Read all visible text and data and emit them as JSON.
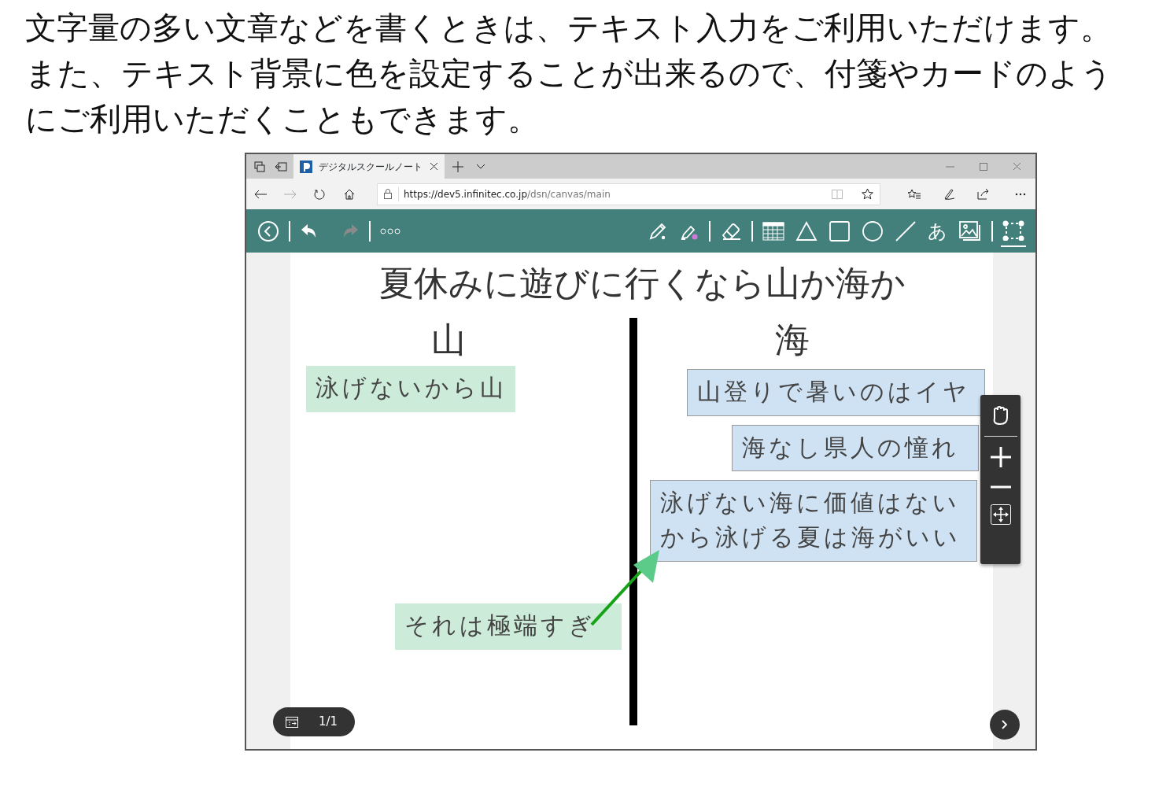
{
  "intro": [
    "文字量の多い文章などを書くときは、テキスト入力をご利用いただけます。",
    "また、テキスト背景に色を設定することが出来るので、付箋やカードのようにご利用いただくこともできます。"
  ],
  "browser": {
    "tab_title": "デジタルスクールノート",
    "url_host": "https://dev5.infinitec.co.jp",
    "url_path": "/dsn/canvas/main"
  },
  "toolbar": {
    "tools": [
      {
        "kind": "pen",
        "selected": false
      },
      {
        "kind": "marker",
        "selected": false
      },
      {
        "kind": "sep"
      },
      {
        "kind": "eraser",
        "selected": false
      },
      {
        "kind": "sep"
      },
      {
        "kind": "table",
        "selected": false
      },
      {
        "kind": "triangle",
        "selected": false
      },
      {
        "kind": "square",
        "selected": false
      },
      {
        "kind": "circle",
        "selected": false
      },
      {
        "kind": "line",
        "selected": false
      },
      {
        "kind": "text",
        "label": "あ",
        "selected": false
      },
      {
        "kind": "image",
        "selected": false
      },
      {
        "kind": "sep"
      },
      {
        "kind": "select",
        "selected": true
      }
    ]
  },
  "canvas": {
    "title": "夏休みに遊びに行くなら山か海か",
    "headings": [
      "山",
      "海"
    ],
    "notes": [
      {
        "text": "泳げないから山",
        "color": "#cdebd9"
      },
      {
        "text": "山登りで暑いのはイヤ",
        "color": "#cfe2f3"
      },
      {
        "text": "海なし県人の憧れ",
        "color": "#cfe2f3"
      },
      {
        "text": "泳げない海に価値はないから泳げる夏は海がいい",
        "color": "#cfe2f3"
      },
      {
        "text": "それは極端すぎ",
        "color": "#cdebd9"
      }
    ],
    "page": "1/1"
  }
}
